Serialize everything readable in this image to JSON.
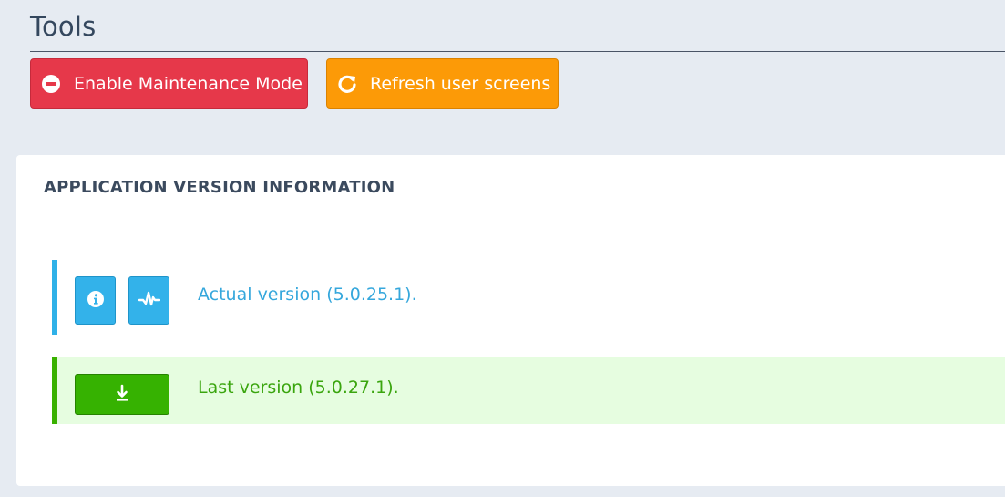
{
  "header": {
    "title": "Tools"
  },
  "toolbar": {
    "maintenance_label": "Enable Maintenance Mode",
    "maintenance_icon": "no-entry-icon",
    "refresh_label": "Refresh user screens",
    "refresh_icon": "refresh-icon"
  },
  "version_card": {
    "title": "APPLICATION VERSION INFORMATION",
    "actual": {
      "text": "Actual version (5.0.25.1).",
      "icons": [
        "info-icon",
        "pulse-icon"
      ],
      "color": "#35a7dc"
    },
    "last": {
      "text": "Last version (5.0.27.1).",
      "icon": "download-icon",
      "color": "#3aa50e"
    }
  },
  "colors": {
    "danger": "#e6384a",
    "warning": "#fc9a07",
    "info": "#33b2ea",
    "success": "#36b201",
    "background": "#e6ebf2"
  }
}
